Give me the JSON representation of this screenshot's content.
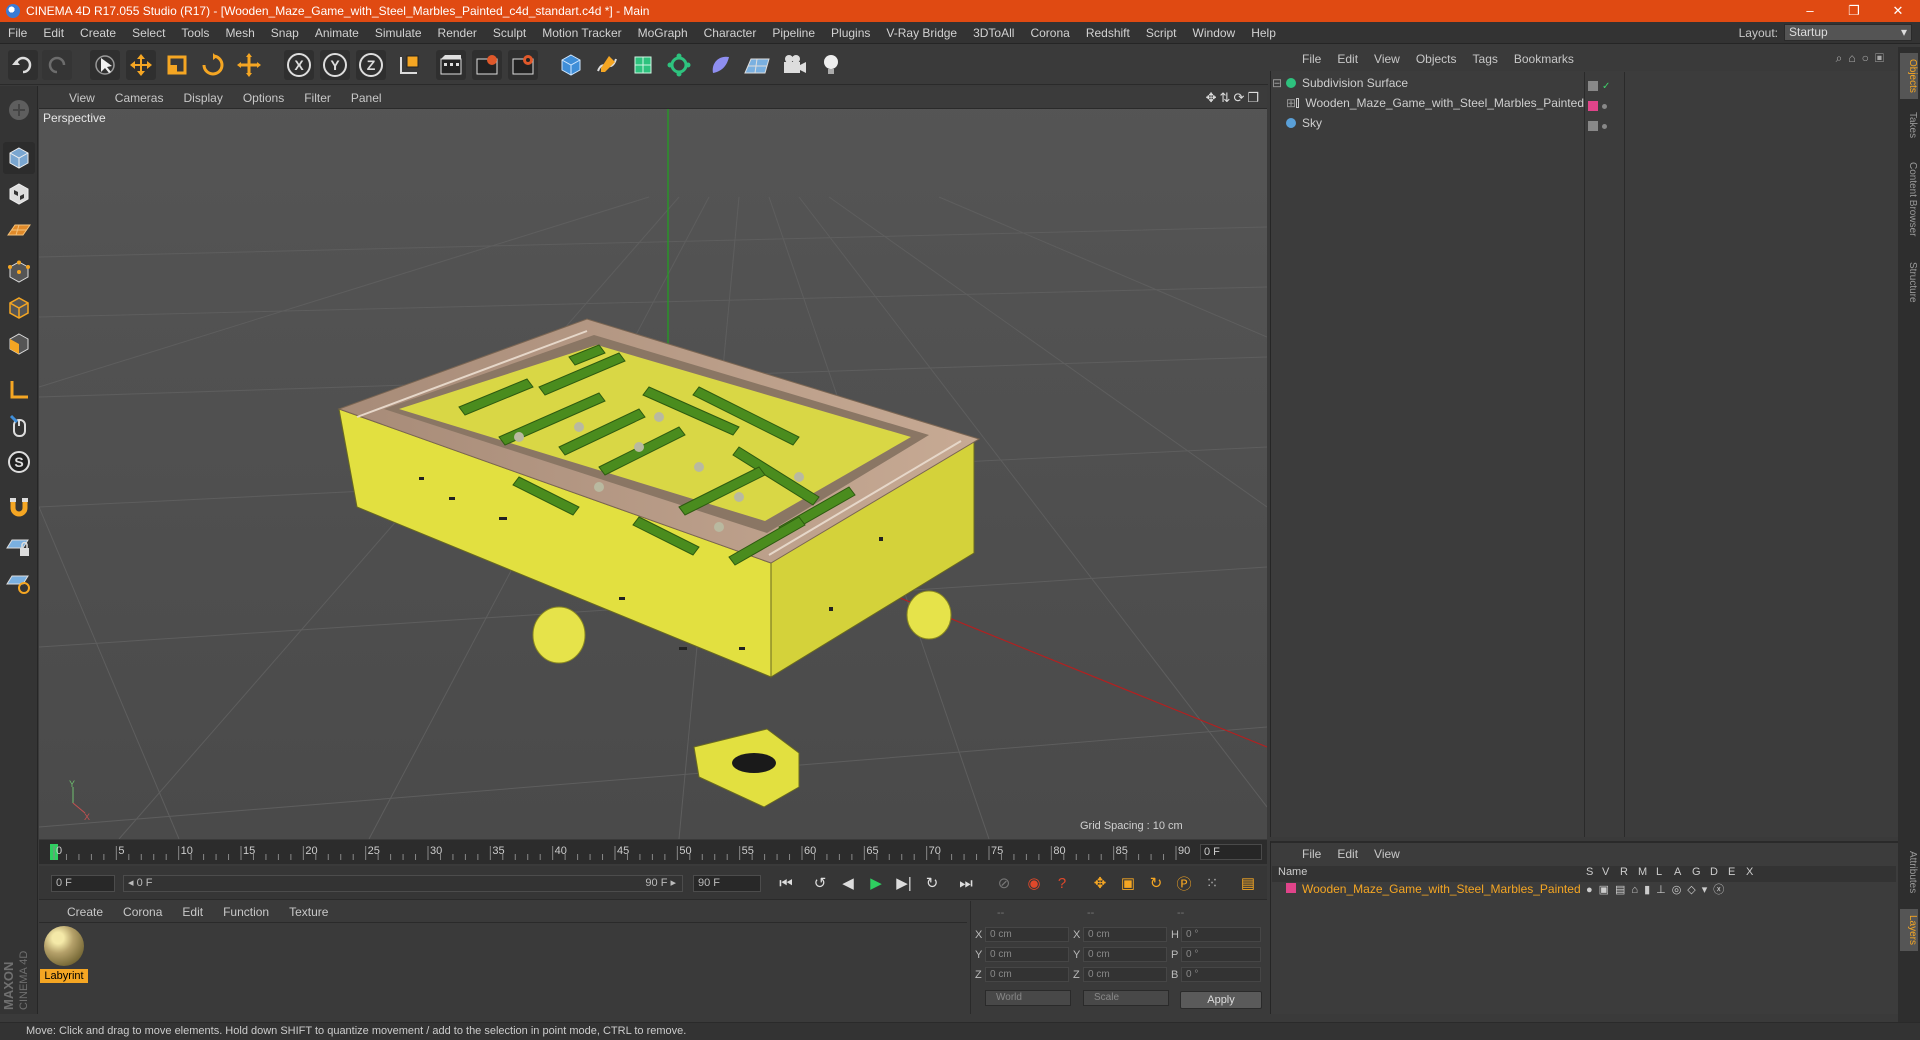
{
  "window": {
    "title": "CINEMA 4D R17.055 Studio (R17) - [Wooden_Maze_Game_with_Steel_Marbles_Painted_c4d_standart.c4d *] - Main",
    "controls": [
      "–",
      "❐",
      "✕"
    ]
  },
  "menu": [
    "File",
    "Edit",
    "Create",
    "Select",
    "Tools",
    "Mesh",
    "Snap",
    "Animate",
    "Simulate",
    "Render",
    "Sculpt",
    "Motion Tracker",
    "MoGraph",
    "Character",
    "Pipeline",
    "Plugins",
    "V-Ray Bridge",
    "3DToAll",
    "Corona",
    "Redshift",
    "Script",
    "Window",
    "Help"
  ],
  "layout": {
    "label": "Layout:",
    "value": "Startup"
  },
  "toolbar": {
    "axis_x": "X",
    "axis_y": "Y",
    "axis_z": "Z"
  },
  "viewport": {
    "menu": [
      "View",
      "Cameras",
      "Display",
      "Options",
      "Filter",
      "Panel"
    ],
    "camera_label": "Perspective",
    "grid_spacing": "Grid Spacing : 10 cm",
    "axis_y": "Y",
    "axis_x": "X"
  },
  "timeline": {
    "ticks": [
      "0",
      "5",
      "10",
      "15",
      "20",
      "25",
      "30",
      "35",
      "40",
      "45",
      "50",
      "55",
      "60",
      "65",
      "70",
      "75",
      "80",
      "85",
      "90"
    ],
    "current_frame": "0 F",
    "start_field": "0 F",
    "range_start": "◂ 0 F",
    "range_end": "90 F ▸",
    "end_field": "90 F"
  },
  "materials": {
    "menu": [
      "Create",
      "Corona",
      "Edit",
      "Function",
      "Texture"
    ],
    "items": [
      {
        "name": "Labyrint"
      }
    ]
  },
  "coordinates": {
    "headers": [
      "--",
      "--",
      "--"
    ],
    "rows": [
      {
        "axis": "X",
        "pos": "0 cm",
        "size_axis": "X",
        "size": "0 cm",
        "rot_axis": "H",
        "rot": "0 °"
      },
      {
        "axis": "Y",
        "pos": "0 cm",
        "size_axis": "Y",
        "size": "0 cm",
        "rot_axis": "P",
        "rot": "0 °"
      },
      {
        "axis": "Z",
        "pos": "0 cm",
        "size_axis": "Z",
        "size": "0 cm",
        "rot_axis": "B",
        "rot": "0 °"
      }
    ],
    "mode": "World",
    "scale": "Scale",
    "apply": "Apply"
  },
  "objects": {
    "menu": [
      "File",
      "Edit",
      "View",
      "Objects",
      "Tags",
      "Bookmarks"
    ],
    "items": [
      {
        "name": "Subdivision Surface",
        "color": "#2ec27e"
      },
      {
        "name": "Wooden_Maze_Game_with_Steel_Marbles_Painted",
        "color": "#cccccc"
      },
      {
        "name": "Sky",
        "color": "#5aa0d8"
      }
    ]
  },
  "layers": {
    "menu": [
      "File",
      "Edit",
      "View"
    ],
    "columns": [
      "Name",
      "S",
      "V",
      "R",
      "M",
      "L",
      "A",
      "G",
      "D",
      "E",
      "X"
    ],
    "items": [
      {
        "name": "Wooden_Maze_Game_with_Steel_Marbles_Painted",
        "color": "#e0448a"
      }
    ]
  },
  "right_tabs": [
    "Objects",
    "Takes",
    "Content Browser",
    "Structure",
    "Attributes",
    "Layers"
  ],
  "brand": {
    "line1": "MAXON",
    "line2": "CINEMA 4D"
  },
  "status": "Move: Click and drag to move elements. Hold down SHIFT to quantize movement / add to the selection in point mode, CTRL to remove."
}
